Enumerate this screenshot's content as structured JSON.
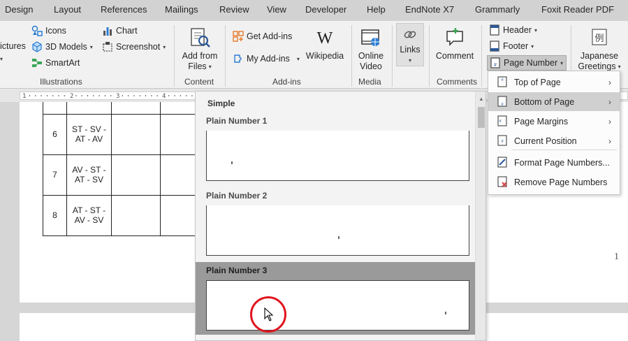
{
  "tabs": [
    "Design",
    "Layout",
    "References",
    "Mailings",
    "Review",
    "View",
    "Developer",
    "Help",
    "EndNote X7",
    "Grammarly",
    "Foxit Reader PDF"
  ],
  "ribbon": {
    "illustrations": {
      "pictures": "ictures",
      "icons": "Icons",
      "models_3d": "3D Models",
      "smartart": "SmartArt",
      "chart": "Chart",
      "screenshot": "Screenshot",
      "label": "Illustrations"
    },
    "content": {
      "add_from_files_1": "Add from",
      "add_from_files_2": "Files",
      "label": "Content"
    },
    "addins": {
      "get_addins": "Get Add-ins",
      "my_addins": "My Add-ins",
      "wikipedia": "Wikipedia",
      "label": "Add-ins"
    },
    "media": {
      "online_video_1": "Online",
      "online_video_2": "Video",
      "label": "Media"
    },
    "links": {
      "links": "Links"
    },
    "comments": {
      "comment": "Comment",
      "label": "Comments"
    },
    "header_footer": {
      "header": "Header",
      "footer": "Footer",
      "page_number": "Page Number"
    },
    "text": {
      "japanese_1": "Japanese",
      "japanese_2": "Greetings"
    }
  },
  "table": {
    "rows": [
      {
        "num": "6",
        "seq_1": "ST - SV -",
        "seq_2": "AT - AV"
      },
      {
        "num": "7",
        "seq_1": "AV - ST -",
        "seq_2": "AT - SV"
      },
      {
        "num": "8",
        "seq_1": "AT - ST -",
        "seq_2": "AV - SV"
      }
    ]
  },
  "page_number_text": "1",
  "gallery": {
    "section": "Simple",
    "items": [
      {
        "label": "Plain Number 1",
        "align": "left",
        "highlighted": false
      },
      {
        "label": "Plain Number 2",
        "align": "center",
        "highlighted": false
      },
      {
        "label": "Plain Number 3",
        "align": "right",
        "highlighted": true
      }
    ]
  },
  "submenu": {
    "items": [
      {
        "label": "Top of Page",
        "icon": "page-top-icon",
        "has_arrow": true,
        "highlighted": false
      },
      {
        "label": "Bottom of Page",
        "icon": "page-bottom-icon",
        "has_arrow": true,
        "highlighted": true
      },
      {
        "label": "Page Margins",
        "icon": "page-margins-icon",
        "has_arrow": true,
        "highlighted": false
      },
      {
        "label": "Current Position",
        "icon": "current-position-icon",
        "has_arrow": true,
        "highlighted": false
      },
      {
        "label": "Format Page Numbers...",
        "icon": "format-page-numbers-icon",
        "has_arrow": false,
        "highlighted": false
      },
      {
        "label": "Remove Page Numbers",
        "icon": "remove-page-numbers-icon",
        "has_arrow": false,
        "highlighted": false
      }
    ]
  },
  "colors": {
    "highlight_ring": "#e0141e",
    "accent_blue": "#2b5797",
    "orange": "#e87a2b"
  }
}
